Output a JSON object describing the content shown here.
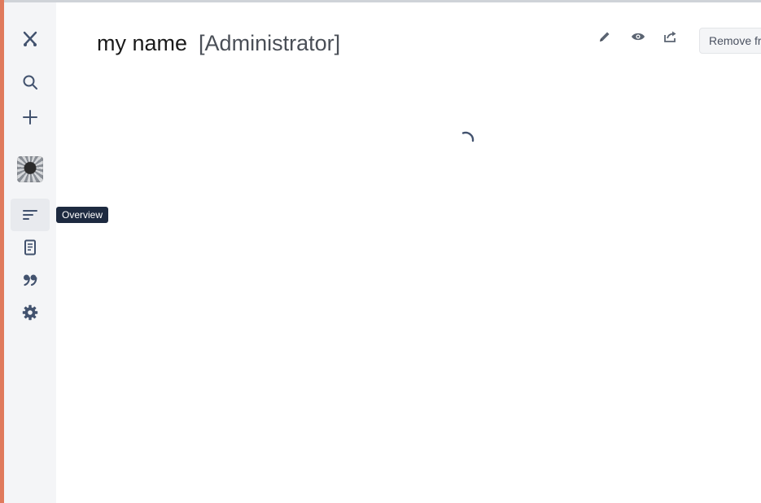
{
  "sidebar": {
    "items": [
      {
        "name": "logo",
        "icon": "crossed-swords-icon"
      },
      {
        "name": "search",
        "icon": "search-icon"
      },
      {
        "name": "create",
        "icon": "plus-icon"
      },
      {
        "name": "avatar",
        "icon": "avatar-image"
      },
      {
        "name": "overview",
        "icon": "overview-lines-icon",
        "active": true
      },
      {
        "name": "document",
        "icon": "document-icon"
      },
      {
        "name": "quote",
        "icon": "quote-icon"
      },
      {
        "name": "settings",
        "icon": "gear-icon"
      }
    ],
    "tooltip": "Overview"
  },
  "header": {
    "name": "my name",
    "role": "[Administrator]",
    "actions": [
      {
        "name": "edit",
        "icon": "pencil-icon"
      },
      {
        "name": "view",
        "icon": "eye-icon"
      },
      {
        "name": "share",
        "icon": "share-icon"
      }
    ],
    "remove_label": "Remove fr"
  },
  "main": {
    "loading": true
  },
  "colors": {
    "sidebar_bg": "#f4f5f7",
    "accent_left": "#e07a5c",
    "icon": "#42526e",
    "tooltip_bg": "#1d2a40"
  }
}
